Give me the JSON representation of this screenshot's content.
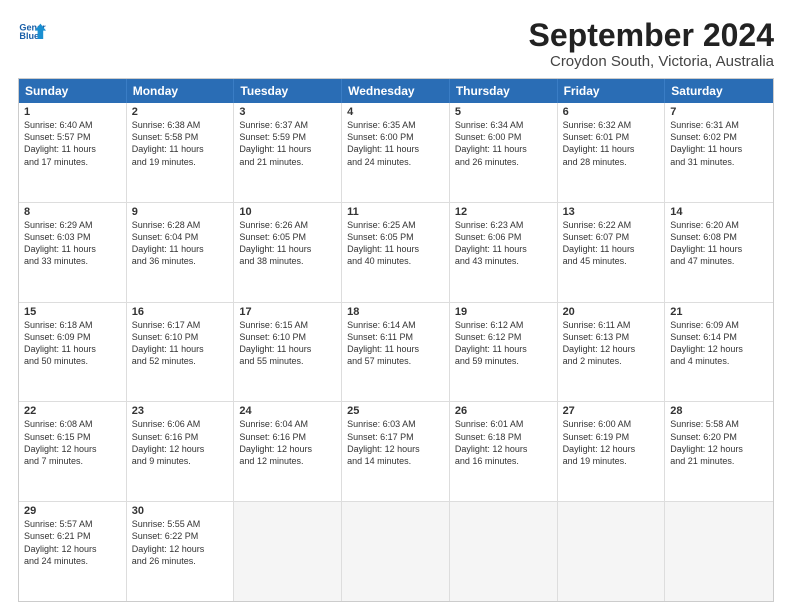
{
  "logo": {
    "line1": "General",
    "line2": "Blue"
  },
  "title": "September 2024",
  "subtitle": "Croydon South, Victoria, Australia",
  "days": [
    "Sunday",
    "Monday",
    "Tuesday",
    "Wednesday",
    "Thursday",
    "Friday",
    "Saturday"
  ],
  "rows": [
    [
      {
        "day": "",
        "empty": true
      },
      {
        "day": "2",
        "lines": [
          "Sunrise: 6:38 AM",
          "Sunset: 5:58 PM",
          "Daylight: 11 hours",
          "and 19 minutes."
        ]
      },
      {
        "day": "3",
        "lines": [
          "Sunrise: 6:37 AM",
          "Sunset: 5:59 PM",
          "Daylight: 11 hours",
          "and 21 minutes."
        ]
      },
      {
        "day": "4",
        "lines": [
          "Sunrise: 6:35 AM",
          "Sunset: 6:00 PM",
          "Daylight: 11 hours",
          "and 24 minutes."
        ]
      },
      {
        "day": "5",
        "lines": [
          "Sunrise: 6:34 AM",
          "Sunset: 6:00 PM",
          "Daylight: 11 hours",
          "and 26 minutes."
        ]
      },
      {
        "day": "6",
        "lines": [
          "Sunrise: 6:32 AM",
          "Sunset: 6:01 PM",
          "Daylight: 11 hours",
          "and 28 minutes."
        ]
      },
      {
        "day": "7",
        "lines": [
          "Sunrise: 6:31 AM",
          "Sunset: 6:02 PM",
          "Daylight: 11 hours",
          "and 31 minutes."
        ]
      }
    ],
    [
      {
        "day": "8",
        "lines": [
          "Sunrise: 6:29 AM",
          "Sunset: 6:03 PM",
          "Daylight: 11 hours",
          "and 33 minutes."
        ]
      },
      {
        "day": "9",
        "lines": [
          "Sunrise: 6:28 AM",
          "Sunset: 6:04 PM",
          "Daylight: 11 hours",
          "and 36 minutes."
        ]
      },
      {
        "day": "10",
        "lines": [
          "Sunrise: 6:26 AM",
          "Sunset: 6:05 PM",
          "Daylight: 11 hours",
          "and 38 minutes."
        ]
      },
      {
        "day": "11",
        "lines": [
          "Sunrise: 6:25 AM",
          "Sunset: 6:05 PM",
          "Daylight: 11 hours",
          "and 40 minutes."
        ]
      },
      {
        "day": "12",
        "lines": [
          "Sunrise: 6:23 AM",
          "Sunset: 6:06 PM",
          "Daylight: 11 hours",
          "and 43 minutes."
        ]
      },
      {
        "day": "13",
        "lines": [
          "Sunrise: 6:22 AM",
          "Sunset: 6:07 PM",
          "Daylight: 11 hours",
          "and 45 minutes."
        ]
      },
      {
        "day": "14",
        "lines": [
          "Sunrise: 6:20 AM",
          "Sunset: 6:08 PM",
          "Daylight: 11 hours",
          "and 47 minutes."
        ]
      }
    ],
    [
      {
        "day": "15",
        "lines": [
          "Sunrise: 6:18 AM",
          "Sunset: 6:09 PM",
          "Daylight: 11 hours",
          "and 50 minutes."
        ]
      },
      {
        "day": "16",
        "lines": [
          "Sunrise: 6:17 AM",
          "Sunset: 6:10 PM",
          "Daylight: 11 hours",
          "and 52 minutes."
        ]
      },
      {
        "day": "17",
        "lines": [
          "Sunrise: 6:15 AM",
          "Sunset: 6:10 PM",
          "Daylight: 11 hours",
          "and 55 minutes."
        ]
      },
      {
        "day": "18",
        "lines": [
          "Sunrise: 6:14 AM",
          "Sunset: 6:11 PM",
          "Daylight: 11 hours",
          "and 57 minutes."
        ]
      },
      {
        "day": "19",
        "lines": [
          "Sunrise: 6:12 AM",
          "Sunset: 6:12 PM",
          "Daylight: 11 hours",
          "and 59 minutes."
        ]
      },
      {
        "day": "20",
        "lines": [
          "Sunrise: 6:11 AM",
          "Sunset: 6:13 PM",
          "Daylight: 12 hours",
          "and 2 minutes."
        ]
      },
      {
        "day": "21",
        "lines": [
          "Sunrise: 6:09 AM",
          "Sunset: 6:14 PM",
          "Daylight: 12 hours",
          "and 4 minutes."
        ]
      }
    ],
    [
      {
        "day": "22",
        "lines": [
          "Sunrise: 6:08 AM",
          "Sunset: 6:15 PM",
          "Daylight: 12 hours",
          "and 7 minutes."
        ]
      },
      {
        "day": "23",
        "lines": [
          "Sunrise: 6:06 AM",
          "Sunset: 6:16 PM",
          "Daylight: 12 hours",
          "and 9 minutes."
        ]
      },
      {
        "day": "24",
        "lines": [
          "Sunrise: 6:04 AM",
          "Sunset: 6:16 PM",
          "Daylight: 12 hours",
          "and 12 minutes."
        ]
      },
      {
        "day": "25",
        "lines": [
          "Sunrise: 6:03 AM",
          "Sunset: 6:17 PM",
          "Daylight: 12 hours",
          "and 14 minutes."
        ]
      },
      {
        "day": "26",
        "lines": [
          "Sunrise: 6:01 AM",
          "Sunset: 6:18 PM",
          "Daylight: 12 hours",
          "and 16 minutes."
        ]
      },
      {
        "day": "27",
        "lines": [
          "Sunrise: 6:00 AM",
          "Sunset: 6:19 PM",
          "Daylight: 12 hours",
          "and 19 minutes."
        ]
      },
      {
        "day": "28",
        "lines": [
          "Sunrise: 5:58 AM",
          "Sunset: 6:20 PM",
          "Daylight: 12 hours",
          "and 21 minutes."
        ]
      }
    ],
    [
      {
        "day": "29",
        "lines": [
          "Sunrise: 5:57 AM",
          "Sunset: 6:21 PM",
          "Daylight: 12 hours",
          "and 24 minutes."
        ]
      },
      {
        "day": "30",
        "lines": [
          "Sunrise: 5:55 AM",
          "Sunset: 6:22 PM",
          "Daylight: 12 hours",
          "and 26 minutes."
        ]
      },
      {
        "day": "",
        "empty": true
      },
      {
        "day": "",
        "empty": true
      },
      {
        "day": "",
        "empty": true
      },
      {
        "day": "",
        "empty": true
      },
      {
        "day": "",
        "empty": true
      }
    ]
  ],
  "row0_day1": {
    "day": "1",
    "lines": [
      "Sunrise: 6:40 AM",
      "Sunset: 5:57 PM",
      "Daylight: 11 hours",
      "and 17 minutes."
    ]
  }
}
